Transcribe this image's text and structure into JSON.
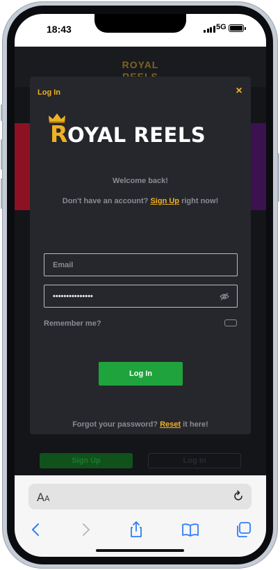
{
  "status_bar": {
    "time": "18:43",
    "network": "5G"
  },
  "background_site": {
    "logo_text": "ROYAL REELS",
    "signup_label": "Sign Up",
    "login_label": "Log In"
  },
  "modal": {
    "title": "Log In",
    "close_icon": "×",
    "logo_initial": "R",
    "logo_rest": "OYAL REELS",
    "welcome": "Welcome back!",
    "signup_prompt": "Don't have an account?",
    "signup_link": "Sign Up",
    "signup_suffix": "right now!",
    "email_placeholder": "Email",
    "password_value": "•••••••••••••••",
    "remember_label": "Remember me?",
    "login_button": "Log In",
    "forgot_prompt": "Forgot your password?",
    "reset_link": "Reset",
    "reset_suffix": "it here!"
  },
  "browser": {
    "aa_large": "A",
    "aa_small": "A"
  },
  "colors": {
    "accent": "#f0b222",
    "primary_button": "#1fa33c",
    "modal_bg": "#26272c",
    "page_bg": "#141519",
    "muted_text": "#8a8c93"
  }
}
